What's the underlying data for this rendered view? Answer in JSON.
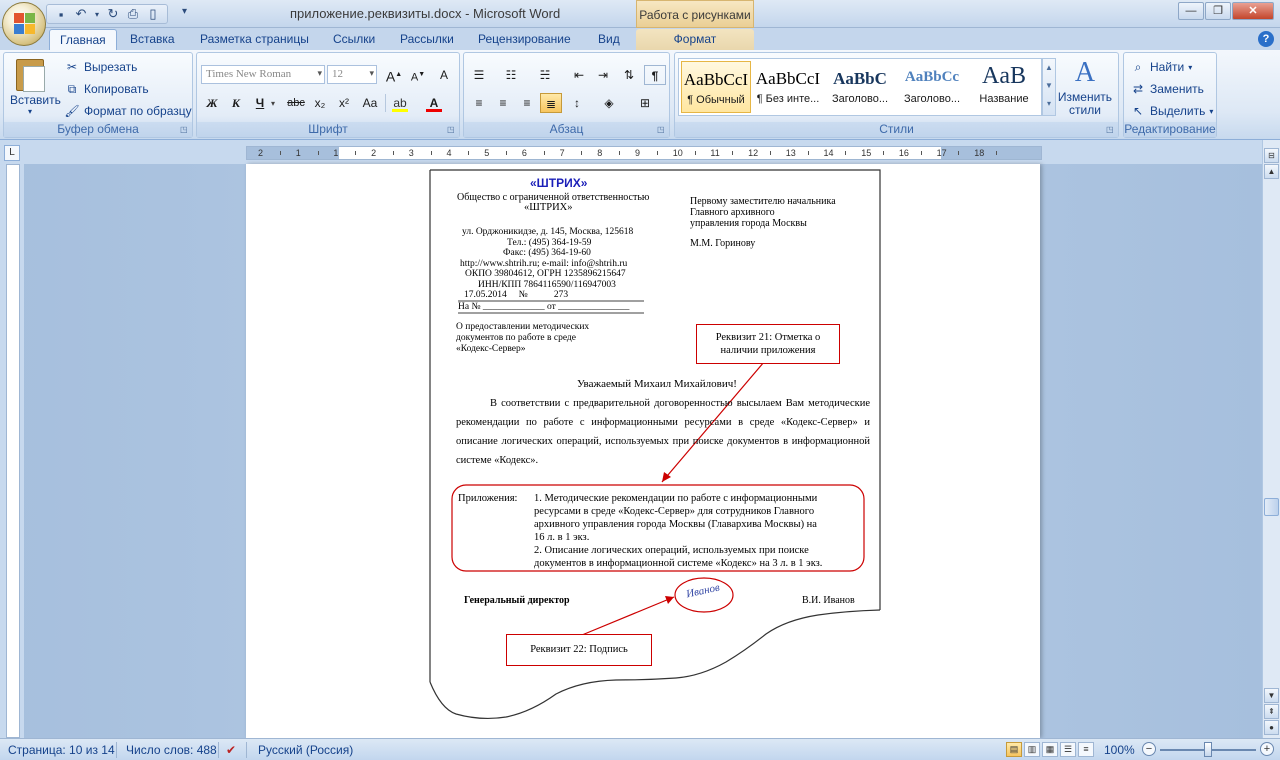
{
  "window": {
    "title": "приложение.реквизиты.docx - Microsoft Word",
    "context_tab_title": "Работа с рисунками",
    "quick_access": [
      "save-icon",
      "undo-icon",
      "redo-icon",
      "print-preview-icon",
      "new-doc-icon",
      "customize-icon"
    ]
  },
  "tabs": {
    "home": "Главная",
    "insert": "Вставка",
    "page_layout": "Разметка страницы",
    "references": "Ссылки",
    "mailings": "Рассылки",
    "review": "Рецензирование",
    "view": "Вид",
    "format": "Формат"
  },
  "ribbon": {
    "clipboard": {
      "paste": "Вставить",
      "cut": "Вырезать",
      "copy": "Копировать",
      "format_painter": "Формат по образцу",
      "label": "Буфер обмена"
    },
    "font": {
      "font_name": "Times New Roman",
      "font_size": "12",
      "bold": "Ж",
      "italic": "К",
      "underline": "Ч",
      "strike": "abc",
      "subscript": "x₂",
      "superscript": "x²",
      "change_case": "Aa",
      "grow": "A",
      "shrink": "A",
      "clear": "A",
      "label": "Шрифт"
    },
    "paragraph": {
      "label": "Абзац"
    },
    "styles": {
      "items": [
        {
          "sample": "AaBbCcI",
          "name": "¶ Обычный"
        },
        {
          "sample": "AaBbCcI",
          "name": "¶ Без инте..."
        },
        {
          "sample": "AaBbC",
          "name": "Заголово..."
        },
        {
          "sample": "AaBbCc",
          "name": "Заголово..."
        },
        {
          "sample": "AaB",
          "name": "Название"
        }
      ],
      "change_styles": "Изменить стили",
      "label": "Стили"
    },
    "editing": {
      "find": "Найти",
      "replace": "Заменить",
      "select": "Выделить",
      "label": "Редактирование"
    }
  },
  "ruler": {
    "numbers": [
      "2",
      "1",
      "1",
      "2",
      "3",
      "4",
      "5",
      "6",
      "7",
      "8",
      "9",
      "10",
      "11",
      "12",
      "13",
      "14",
      "15",
      "16",
      "17",
      "18"
    ]
  },
  "document": {
    "logo": "«ШТРИХ»",
    "org_line1": "Общество с ограниченной ответственностью",
    "org_line2": "«ШТРИХ»",
    "address": "ул. Орджоникидзе, д. 145, Москва, 125618",
    "phone": "Тел.: (495) 364-19-59",
    "fax": "Факс: (495) 364-19-60",
    "web": "http://www.shtrih.ru; e-mail: info@shtrih.ru",
    "okpo": "ОКПО 39804612, ОГРН 1235896215647",
    "inn": "ИНН/КПП 7864116590/116947003",
    "date_line": "17.05.2014     №           273",
    "reply_line": "На № _____________ от _______________",
    "recipient1": "Первому заместителю начальника",
    "recipient2": "Главного архивного",
    "recipient3": "управления города Москвы",
    "recipient_name": "М.М. Горинову",
    "subject1": "О предоставлении методических",
    "subject2": "документов по работе в среде",
    "subject3": "«Кодекс-Сервер»",
    "salutation": "Уважаемый Михаил Михайлович!",
    "body": "В соответствии с предварительной договоренностью высылаем Вам методические рекомендации по работе с информационными ресурсами в среде «Кодекс-Сервер» и описание логических операций, используемых при поиске документов в информационной системе «Кодекс».",
    "appendix_label": "Приложения:",
    "appendix1_l1": "1. Методические рекомендации по работе с информационными",
    "appendix1_l2": "ресурсами в среде «Кодекс-Сервер»  для сотрудников Главного",
    "appendix1_l3": "архивного управления города Москвы  (Главархива Москвы) на",
    "appendix1_l4": "16 л. в 1 экз.",
    "appendix2_l1": "2. Описание логических операций, используемых при поиске",
    "appendix2_l2": "документов в информационной системе «Кодекс» на 3 л. в 1 экз.",
    "signer_title": "Генеральный директор",
    "signer_name": "В.И. Иванов",
    "signature_text": "Иванов",
    "callout21": "Реквизит 21: Отметка о наличии приложения",
    "callout22": "Реквизит 22: Подпись"
  },
  "status": {
    "page": "Страница: 10 из 14",
    "words": "Число слов: 488",
    "language": "Русский (Россия)",
    "zoom": "100%"
  },
  "colors": {
    "accent": "#15428b",
    "callout_border": "#c00000",
    "logo": "#1b1fb8",
    "context_tab": "#eacf95"
  }
}
